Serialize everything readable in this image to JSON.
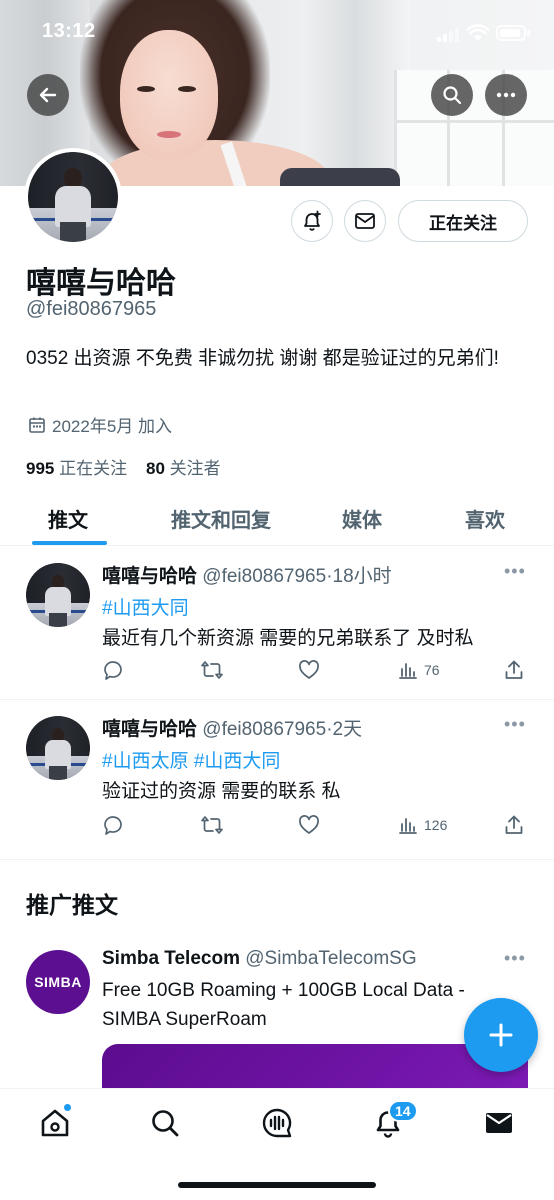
{
  "status_bar": {
    "time": "13:12"
  },
  "profile": {
    "name": "嘻嘻与哈哈",
    "handle": "@fei80867965",
    "bio": "0352 出资源 不免费 非诚勿扰 谢谢 都是验证过的兄弟们!",
    "joined": "2022年5月 加入",
    "following_count": "995",
    "following_label": "正在关注",
    "followers_count": "80",
    "followers_label": "关注者",
    "follow_button": "正在关注"
  },
  "tabs": [
    {
      "label": "推文",
      "active": true
    },
    {
      "label": "推文和回复",
      "active": false
    },
    {
      "label": "媒体",
      "active": false
    },
    {
      "label": "喜欢",
      "active": false
    }
  ],
  "tweets": [
    {
      "name": "嘻嘻与哈哈",
      "handle": "@fei80867965",
      "time": "·18小时",
      "tags": "#山西大同",
      "text": "最近有几个新资源 需要的兄弟联系了 及时私",
      "views": "76"
    },
    {
      "name": "嘻嘻与哈哈",
      "handle": "@fei80867965",
      "time": "·2天",
      "tags": "#山西太原 #山西大同",
      "text": "验证过的资源 需要的联系 私",
      "views": "126"
    }
  ],
  "promoted": {
    "section_title": "推广推文",
    "logo_text": "SIMBA",
    "name": "Simba Telecom",
    "handle": "@SimbaTelecomSG",
    "text": "Free 10GB Roaming + 100GB Local Data - SIMBA SuperRoam"
  },
  "bottom_nav": {
    "notifications_badge": "14"
  },
  "colors": {
    "accent": "#1d9bf0",
    "text": "#0f1419",
    "secondary": "#536471",
    "ad_purple": "#5c0f91"
  }
}
